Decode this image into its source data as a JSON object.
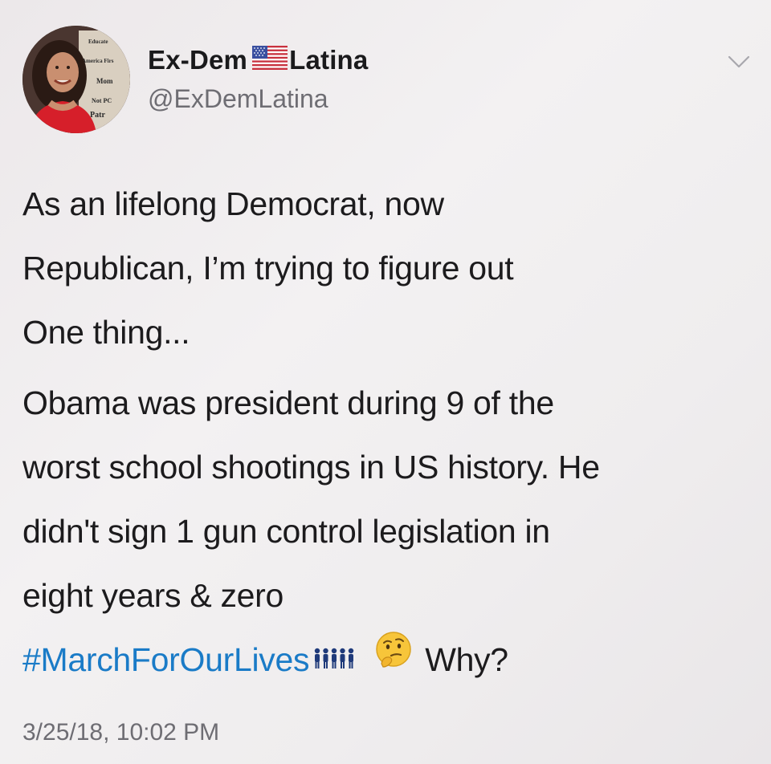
{
  "author": {
    "display_name_part1": "Ex-Dem",
    "display_name_part2": "Latina",
    "handle": "@ExDemLatina",
    "avatar_sign_text": [
      "Educate",
      "America Firs",
      "Mom",
      "Not PC",
      "Patr"
    ]
  },
  "tweet": {
    "paragraph1": [
      "As an lifelong Democrat, now",
      "Republican, I’m trying to figure out",
      "One thing..."
    ],
    "paragraph2": [
      "Obama was president during 9 of the",
      "worst school shootings in US history. He",
      "didn't sign 1 gun control legislation in",
      "eight years & zero"
    ],
    "hashtag": "#MarchForOurLives",
    "trailing_text": "Why?",
    "timestamp": "3/25/18, 10:02 PM"
  },
  "icons": {
    "flag": "us-flag-icon",
    "people": "people-group-icon",
    "thinking": "thinking-face-icon",
    "menu": "chevron-down-icon"
  },
  "colors": {
    "hashtag": "#1a7bc7",
    "secondary_text": "#6e6d73",
    "primary_text": "#1c1b1d"
  }
}
